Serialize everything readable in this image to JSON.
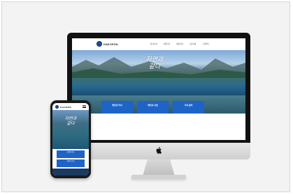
{
  "site": {
    "logo_text": "HAEJEON",
    "nav": [
      "회사소개",
      "사업분야",
      "제품소개",
      "시공사례",
      "고객센터"
    ],
    "hero_title_line1": "자연과",
    "hero_title_line2": "같다",
    "hero_sub": "",
    "cards": [
      {
        "title": "",
        "label": "해전의 역사"
      },
      {
        "title": "",
        "label": "해전의 사업"
      },
      {
        "title": "",
        "label": "국내 실적"
      }
    ]
  },
  "mobile": {
    "logo_text": "HAEJEON",
    "hero_title_line1": "자연과",
    "hero_title_line2": "같다"
  },
  "colors": {
    "accent": "#1e63c8",
    "frame_bg": "#f3f3f3"
  },
  "icons": [
    "apple-logo-icon",
    "menu-icon",
    "logo-icon"
  ]
}
